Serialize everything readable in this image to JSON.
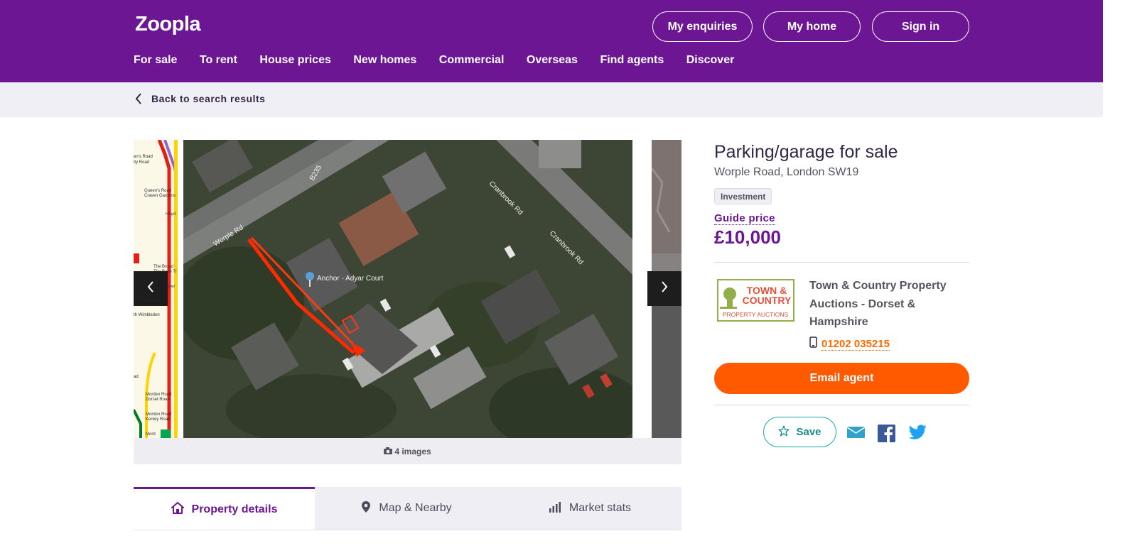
{
  "header": {
    "logo": "Zoopla",
    "buttons": {
      "enquiries": "My enquiries",
      "home": "My home",
      "signin": "Sign in"
    },
    "nav": [
      "For sale",
      "To rent",
      "House prices",
      "New homes",
      "Commercial",
      "Overseas",
      "Find agents",
      "Discover"
    ]
  },
  "back": {
    "label": "Back to search results"
  },
  "gallery": {
    "caption": "4 images",
    "map_labels": {
      "worple": "Worple Rd",
      "b235": "B235",
      "cranbrook1": "Cranbrook Rd",
      "cranbrook2": "Cranbrook Rd",
      "anchor": "Anchor - Adyar Court"
    },
    "tube_labels": [
      "en's Road",
      "ity Road",
      "Queen's Road",
      "Craven Gardens",
      "Hayd",
      "The Broad",
      "The Bake Tr",
      "Mer",
      "th Wimbledon",
      "ad",
      "Morden Road",
      "Dorset Road",
      "Morden Road",
      "Kenley Road",
      "Mord"
    ]
  },
  "tabs": [
    {
      "label": "Property details",
      "icon": "home-icon"
    },
    {
      "label": "Map & Nearby",
      "icon": "location-pin-icon"
    },
    {
      "label": "Market stats",
      "icon": "bar-chart-icon"
    }
  ],
  "listing": {
    "title": "Parking/garage for sale",
    "address": "Worple Road, London SW19",
    "badge": "Investment",
    "guide_label": "Guide price",
    "price": "£10,000"
  },
  "agent": {
    "logo_line1": "TOWN &",
    "logo_line2": "COUNTRY",
    "logo_line3": "PROPERTY AUCTIONS",
    "name": "Town & Country Property Auctions - Dorset & Hampshire",
    "phone": "01202 035215",
    "email_label": "Email agent"
  },
  "actions": {
    "save_label": "Save"
  },
  "colors": {
    "brand": "#6c1694",
    "accent": "#ff5a00",
    "teal": "#1aa8a6"
  }
}
